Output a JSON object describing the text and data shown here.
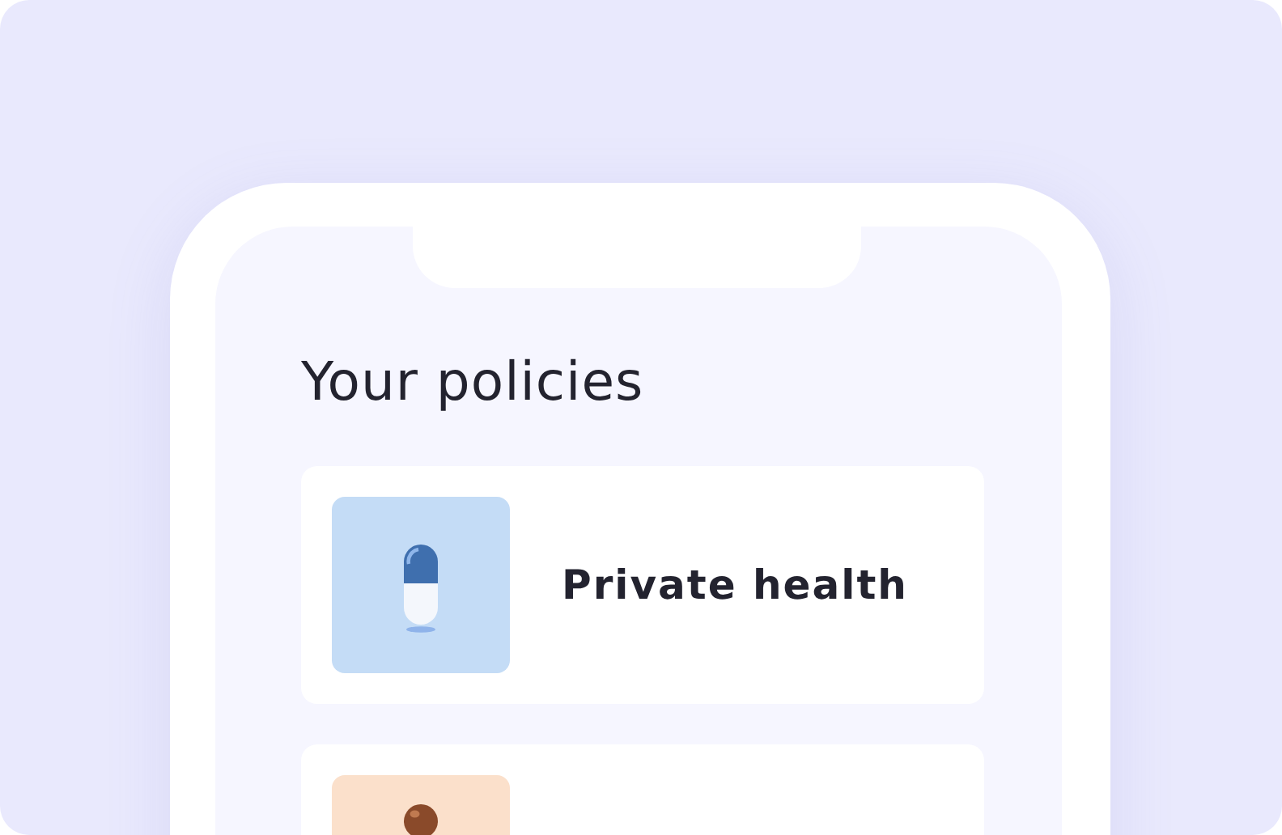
{
  "screen": {
    "title": "Your policies",
    "policies": [
      {
        "kind": "pill",
        "name": "Private health"
      },
      {
        "kind": "jar"
      }
    ]
  }
}
